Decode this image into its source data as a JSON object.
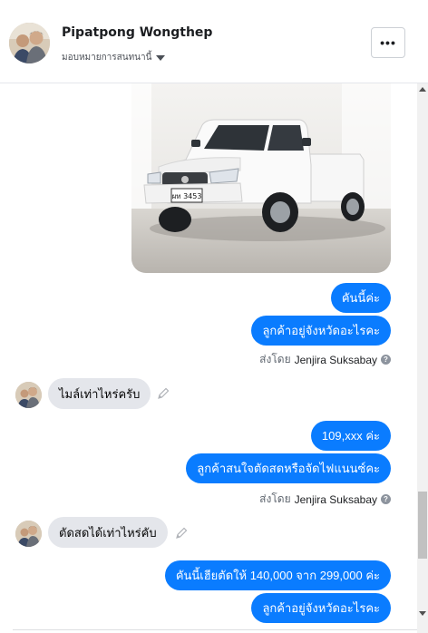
{
  "header": {
    "name": "Pipatpong Wongthep",
    "assign_label": "มอบหมายการสนทนานี้",
    "more_label": "•••"
  },
  "icons": {
    "avatar": "avatar-photo",
    "caret": "caret-down-icon",
    "more": "more-options-icon",
    "help": "question-circle-icon",
    "edit": "pencil-icon",
    "photo": "white-pickup-truck-photo"
  },
  "photo": {
    "plate_text": "ผท 3453"
  },
  "messages": [
    {
      "direction": "out",
      "text": "คันนี้ค่ะ"
    },
    {
      "direction": "out",
      "text": "ลูกค้าอยู่จังหวัดอะไรคะ"
    },
    {
      "sent_by_prefix": "ส่งโดย",
      "sent_by_name": "Jenjira Suksabay"
    },
    {
      "direction": "in",
      "text": "ไมล์เท่าไหร่ครับ"
    },
    {
      "direction": "out",
      "text": "109,xxx ค่ะ"
    },
    {
      "direction": "out",
      "text": "ลูกค้าสนใจตัดสดหรือจัดไฟแนนซ์คะ"
    },
    {
      "sent_by_prefix": "ส่งโดย",
      "sent_by_name": "Jenjira Suksabay"
    },
    {
      "direction": "in",
      "text": "ตัดสดได้เท่าไหร่คับ"
    },
    {
      "direction": "out",
      "text": "คันนี้เฮียตัดให้ 140,000 จาก 299,000 ค่ะ"
    },
    {
      "direction": "out",
      "text": "ลูกค้าอยู่จังหวัดอะไรคะ"
    }
  ],
  "colors": {
    "outgoing_bubble": "#0a7cff",
    "incoming_bubble": "#e4e6eb"
  }
}
